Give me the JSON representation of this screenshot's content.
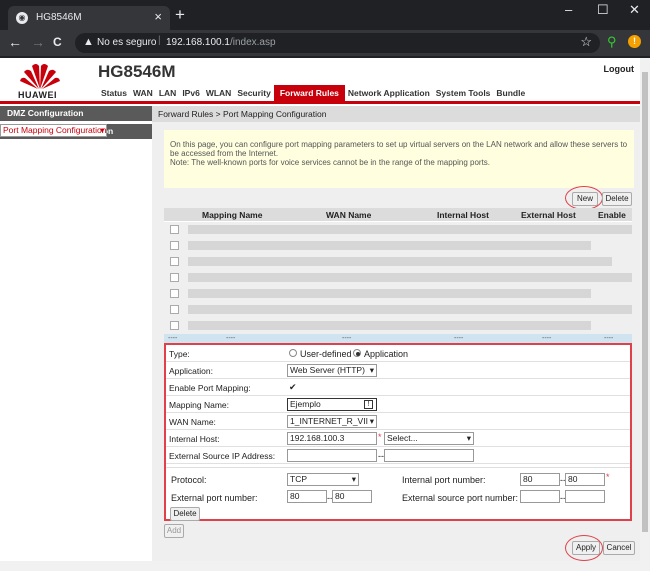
{
  "browser": {
    "tab_title": "HG8546M",
    "tab_close": "×",
    "new_tab": "+",
    "minimize": "–",
    "maximize": "☐",
    "close": "✕",
    "back": "←",
    "forward": "→",
    "reload": "C",
    "warning_icon": "▲",
    "insecure_label": "No es seguro",
    "url_host": "192.168.100.1",
    "url_path": "/index.asp",
    "star": "☆"
  },
  "header": {
    "brand": "HUAWEI",
    "model": "HG8546M",
    "logout": "Logout",
    "menu": [
      "Status",
      "WAN",
      "LAN",
      "IPv6",
      "WLAN",
      "Security",
      "Forward Rules",
      "Network Application",
      "System Tools",
      "Bundle"
    ],
    "active_menu": "Forward Rules"
  },
  "sidebar": {
    "items": [
      "DMZ Configuration",
      "Port Mapping Configuration",
      "Port Trigger Configuration"
    ]
  },
  "breadcrumb": "Forward Rules > Port Mapping Configuration",
  "note": {
    "line1": "On this page, you can configure port mapping parameters to set up virtual servers on the LAN network and allow these servers to be accessed from the Internet.",
    "line2": "Note: The well-known ports for voice services cannot be in the range of the mapping ports."
  },
  "buttons": {
    "new": "New",
    "delete": "Delete",
    "row_delete": "Delete",
    "add": "Add",
    "apply": "Apply",
    "cancel": "Cancel"
  },
  "table": {
    "headers": [
      "Mapping Name",
      "WAN Name",
      "Internal Host",
      "External Host",
      "Enable"
    ],
    "dash": "----"
  },
  "form": {
    "type_label": "Type:",
    "type_options": [
      "User-defined",
      "Application"
    ],
    "type_selected": "Application",
    "application_label": "Application:",
    "application_value": "Web Server (HTTP)",
    "enable_label": "Enable Port Mapping:",
    "enable_checked": true,
    "mapping_name_label": "Mapping Name:",
    "mapping_name_value": "Ejemplo",
    "wan_name_label": "WAN Name:",
    "wan_name_value": "1_INTERNET_R_VII",
    "internal_host_label": "Internal Host:",
    "internal_host_value": "192.168.100.3",
    "internal_host_select": "Select...",
    "ext_src_ip_label": "External Source IP Address:",
    "ext_src_ip_sep": "--",
    "protocol_label": "Protocol:",
    "protocol_value": "TCP",
    "internal_port_label": "Internal port number:",
    "internal_port_from": "80",
    "internal_port_to": "80",
    "external_port_label": "External port number:",
    "external_port_from": "80",
    "external_port_to": "80",
    "ext_src_port_label": "External source port number:",
    "port_sep": "--",
    "required_mark": "*"
  }
}
